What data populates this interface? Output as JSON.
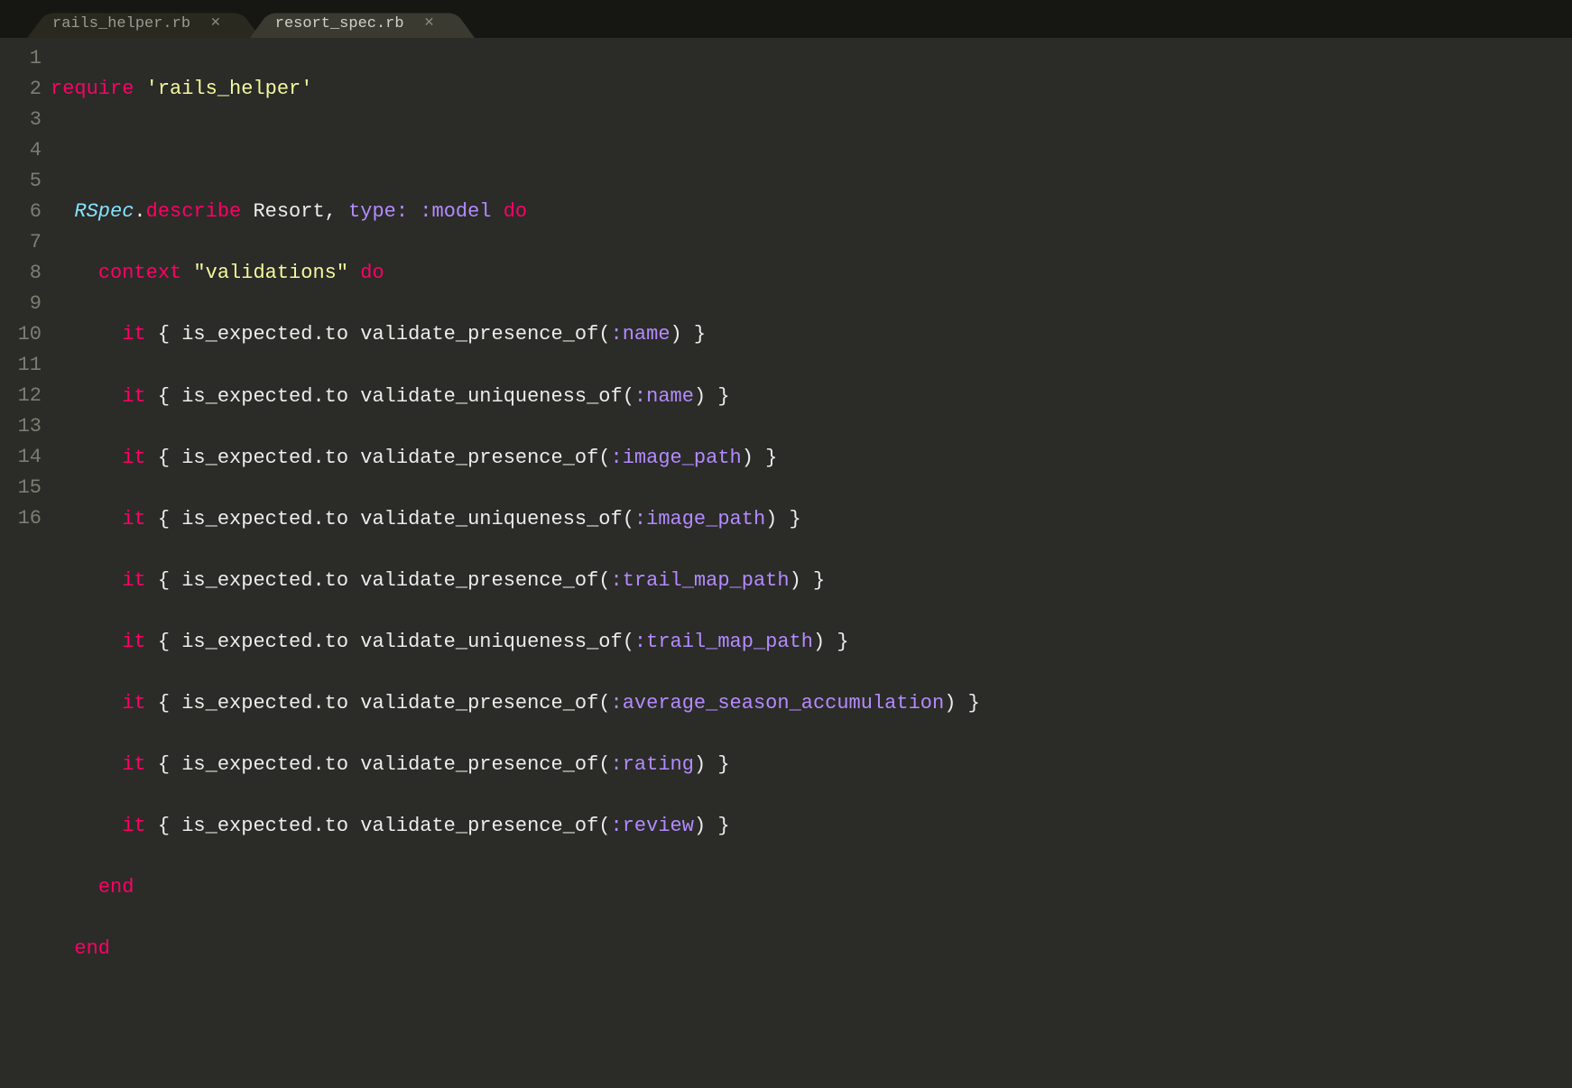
{
  "tabs": [
    {
      "label": "rails_helper.rb",
      "active": false
    },
    {
      "label": "resort_spec.rb",
      "active": true
    }
  ],
  "line_numbers": [
    "1",
    "2",
    "3",
    "4",
    "5",
    "6",
    "7",
    "8",
    "9",
    "10",
    "11",
    "12",
    "13",
    "14",
    "15",
    "16"
  ],
  "code": {
    "l1": {
      "require": "require",
      "str": "'rails_helper'"
    },
    "l3": {
      "rspec": "RSpec",
      "dot": ".",
      "describe": "describe",
      "resort": " Resort, ",
      "type": "type: ",
      "model": ":model",
      "do": " do"
    },
    "l4": {
      "context": "context",
      "str": " \"validations\"",
      "do": " do"
    },
    "l5": {
      "it": "it",
      "body": " { is_expected.to validate_presence_of(",
      "sym": ":name",
      "end": ") }"
    },
    "l6": {
      "it": "it",
      "body": " { is_expected.to validate_uniqueness_of(",
      "sym": ":name",
      "end": ") }"
    },
    "l7": {
      "it": "it",
      "body": " { is_expected.to validate_presence_of(",
      "sym": ":image_path",
      "end": ") }"
    },
    "l8": {
      "it": "it",
      "body": " { is_expected.to validate_uniqueness_of(",
      "sym": ":image_path",
      "end": ") }"
    },
    "l9": {
      "it": "it",
      "body": " { is_expected.to validate_presence_of(",
      "sym": ":trail_map_path",
      "end": ") }"
    },
    "l10": {
      "it": "it",
      "body": " { is_expected.to validate_uniqueness_of(",
      "sym": ":trail_map_path",
      "end": ") }"
    },
    "l11": {
      "it": "it",
      "body": " { is_expected.to validate_presence_of(",
      "sym": ":average_season_accumulation",
      "end": ") }"
    },
    "l12": {
      "it": "it",
      "body": " { is_expected.to validate_presence_of(",
      "sym": ":rating",
      "end": ") }"
    },
    "l13": {
      "it": "it",
      "body": " { is_expected.to validate_presence_of(",
      "sym": ":review",
      "end": ") }"
    },
    "l14": {
      "end": "end"
    },
    "l15": {
      "end": "end"
    }
  }
}
